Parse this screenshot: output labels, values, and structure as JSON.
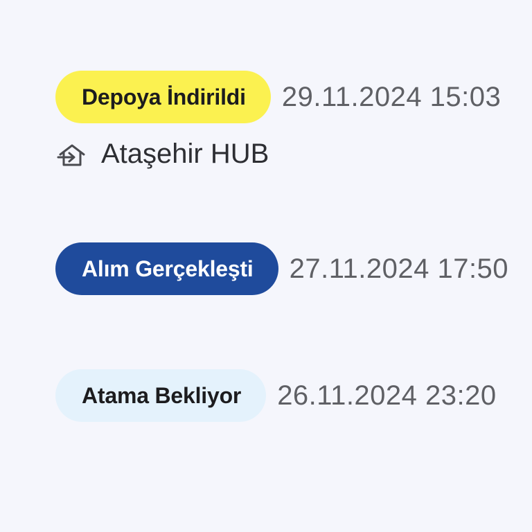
{
  "events": [
    {
      "status": "Depoya İndirildi",
      "time": "29.11.2024 15:03",
      "badge_bg": "#fbf150",
      "badge_fg": "#1c1c1e",
      "location": {
        "icon": "warehouse-arrow-icon",
        "name": "Ataşehir HUB"
      }
    },
    {
      "status": "Alım Gerçekleşti",
      "time": "27.11.2024 17:50",
      "badge_bg": "#1f4b9c",
      "badge_fg": "#ffffff"
    },
    {
      "status": "Atama Bekliyor",
      "time": "26.11.2024 23:20",
      "badge_bg": "#e4f2fc",
      "badge_fg": "#1c1c1e"
    }
  ],
  "colors": {
    "background": "#f5f6fc",
    "time_text": "#5f6065",
    "location_text": "#2d2e33"
  }
}
